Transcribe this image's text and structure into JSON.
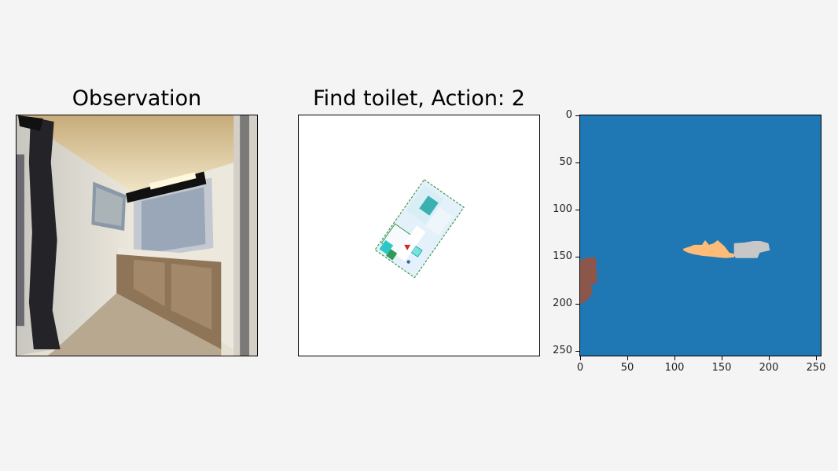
{
  "panels": {
    "observation": {
      "title": "Observation"
    },
    "map": {
      "title": "Find toilet, Action: 2"
    },
    "semantic": {
      "x_ticks": [
        "0",
        "50",
        "100",
        "150",
        "200",
        "250"
      ],
      "y_ticks": [
        "0",
        "50",
        "100",
        "150",
        "200",
        "250"
      ]
    }
  },
  "colors": {
    "background": "#f4f4f4",
    "semantic_bg": "#1f77b4",
    "region_orange": "#ffbb78",
    "region_gray": "#c7c7c7",
    "region_brown": "#8c564b",
    "agent_arrow": "#d62728"
  }
}
